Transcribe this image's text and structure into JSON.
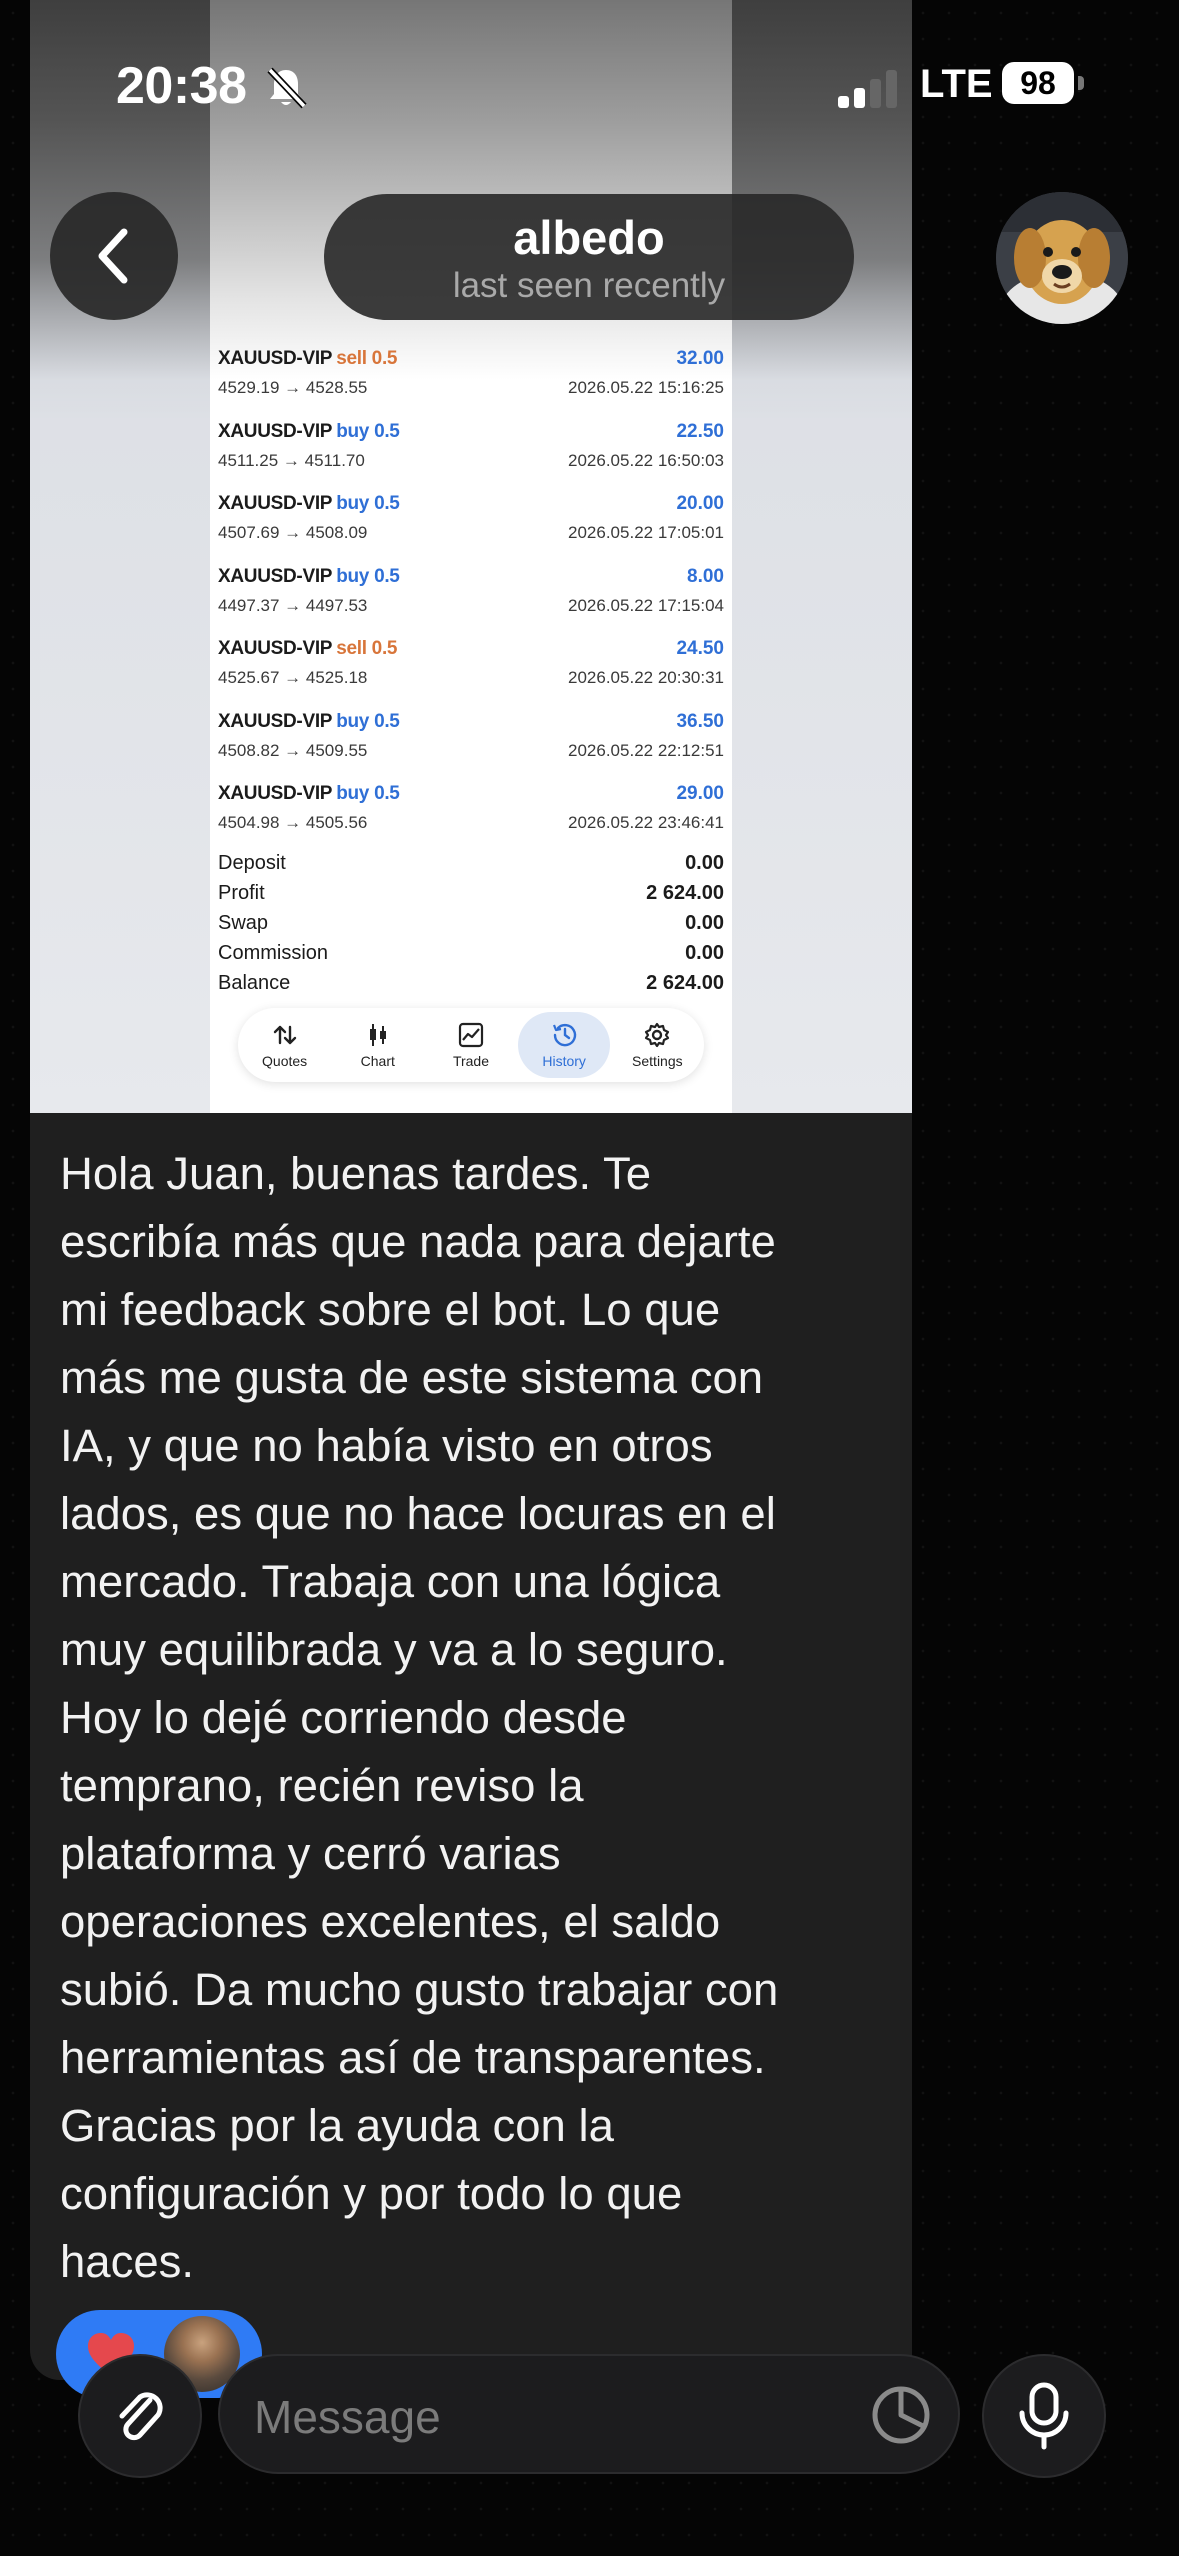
{
  "status_bar": {
    "time": "20:38",
    "network": "LTE",
    "battery": "98"
  },
  "header": {
    "name": "albedo",
    "status": "last seen recently"
  },
  "screenshot": {
    "trades": [
      {
        "symbol": "XAUUSD-VIP",
        "side": "sell",
        "volume": "0.5",
        "price": "4529.19 → 4528.55",
        "profit": "32.00",
        "time": "2026.05.22 15:16:25"
      },
      {
        "symbol": "XAUUSD-VIP",
        "side": "buy",
        "volume": "0.5",
        "price": "4511.25 → 4511.70",
        "profit": "22.50",
        "time": "2026.05.22 16:50:03"
      },
      {
        "symbol": "XAUUSD-VIP",
        "side": "buy",
        "volume": "0.5",
        "price": "4507.69 → 4508.09",
        "profit": "20.00",
        "time": "2026.05.22 17:05:01"
      },
      {
        "symbol": "XAUUSD-VIP",
        "side": "buy",
        "volume": "0.5",
        "price": "4497.37 → 4497.53",
        "profit": "8.00",
        "time": "2026.05.22 17:15:04"
      },
      {
        "symbol": "XAUUSD-VIP",
        "side": "sell",
        "volume": "0.5",
        "price": "4525.67 → 4525.18",
        "profit": "24.50",
        "time": "2026.05.22 20:30:31"
      },
      {
        "symbol": "XAUUSD-VIP",
        "side": "buy",
        "volume": "0.5",
        "price": "4508.82 → 4509.55",
        "profit": "36.50",
        "time": "2026.05.22 22:12:51"
      },
      {
        "symbol": "XAUUSD-VIP",
        "side": "buy",
        "volume": "0.5",
        "price": "4504.98 → 4505.56",
        "profit": "29.00",
        "time": "2026.05.22 23:46:41"
      }
    ],
    "summary": [
      {
        "label": "Deposit",
        "value": "0.00"
      },
      {
        "label": "Profit",
        "value": "2 624.00"
      },
      {
        "label": "Swap",
        "value": "0.00"
      },
      {
        "label": "Commission",
        "value": "0.00"
      },
      {
        "label": "Balance",
        "value": "2 624.00"
      }
    ],
    "tabs": [
      {
        "label": "Quotes",
        "icon": "arrows-updown-icon",
        "active": false
      },
      {
        "label": "Chart",
        "icon": "candles-icon",
        "active": false
      },
      {
        "label": "Trade",
        "icon": "trade-chart-icon",
        "active": false
      },
      {
        "label": "History",
        "icon": "history-clock-icon",
        "active": true
      },
      {
        "label": "Settings",
        "icon": "gear-icon",
        "active": false
      }
    ]
  },
  "message": {
    "text": "Hola Juan, buenas tardes. Te\nescribía más que nada para dejarte\nmi feedback sobre el bot. Lo que\nmás me gusta de este sistema con\nIA, y que no había visto en otros\nlados, es que no hace locuras en el\nmercado. Trabaja con una lógica\nmuy equilibrada y va a lo seguro.\nHoy lo dejé corriendo desde\ntemprano, recién reviso la\nplataforma y cerró varias\noperaciones excelentes, el saldo\nsubió. Da mucho gusto trabajar con\nherramientas así de transparentes.\nGracias por la ayuda con la\nconfiguración y por todo lo que\nhaces."
  },
  "composer": {
    "placeholder": "Message"
  },
  "colors": {
    "buy": "#2f6fd6",
    "sell": "#d8753a",
    "reaction": "#2f7bf5",
    "heart": "#e5484d"
  }
}
